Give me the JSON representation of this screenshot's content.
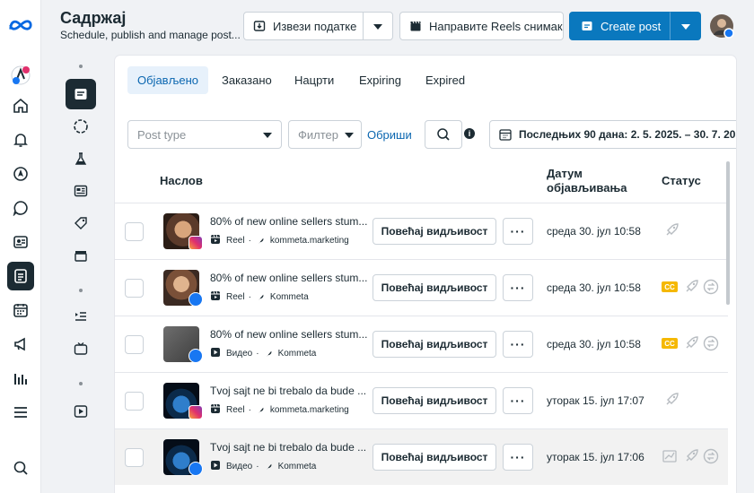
{
  "header": {
    "title": "Садржај",
    "subtitle": "Schedule, publish and manage post...",
    "export_label": "Извези податке",
    "reels_label": "Направите Reels снимак",
    "create_label": "Create post"
  },
  "tabs": [
    {
      "label": "Објављено",
      "active": true
    },
    {
      "label": "Заказано",
      "active": false
    },
    {
      "label": "Нацрти",
      "active": false
    },
    {
      "label": "Expiring",
      "active": false
    },
    {
      "label": "Expired",
      "active": false
    }
  ],
  "filters": {
    "post_type_placeholder": "Post type",
    "filter_placeholder": "Филтер",
    "clear_label": "Обриши",
    "date_range": "Последњих 90 дана: 2. 5. 2025. – 30. 7. 20"
  },
  "table": {
    "col_title": "Наслов",
    "col_date": "Датум објављивања",
    "col_status": "Статус",
    "boost_label": "Повећај видљивост",
    "cc_label": "CC",
    "rows": [
      {
        "title": "80% of new online sellers stum...",
        "type": "Reel",
        "account": "kommeta.marketing",
        "date": "среда 30. јул 10:58",
        "platform": "instagram",
        "cc": false
      },
      {
        "title": "80% of new online sellers stum...",
        "type": "Reel",
        "account": "Kommeta",
        "date": "среда 30. јул 10:58",
        "platform": "facebook",
        "cc": true
      },
      {
        "title": "80% of new online sellers stum...",
        "type": "Видео",
        "account": "Kommeta",
        "date": "среда 30. јул 10:58",
        "platform": "facebook",
        "cc": true
      },
      {
        "title": "Tvoj sajt ne bi trebalo da bude ...",
        "type": "Reel",
        "account": "kommeta.marketing",
        "date": "уторак 15. јул 17:07",
        "platform": "instagram",
        "cc": false
      },
      {
        "title": "Tvoj sajt ne bi trebalo da bude ...",
        "type": "Видео",
        "account": "Kommeta",
        "date": "уторак 15. јул 17:06",
        "platform": "facebook",
        "cc": false
      }
    ]
  },
  "colors": {
    "accent": "#0a78be",
    "dark": "#1c2b33",
    "meta_blue": "#0668e1"
  }
}
